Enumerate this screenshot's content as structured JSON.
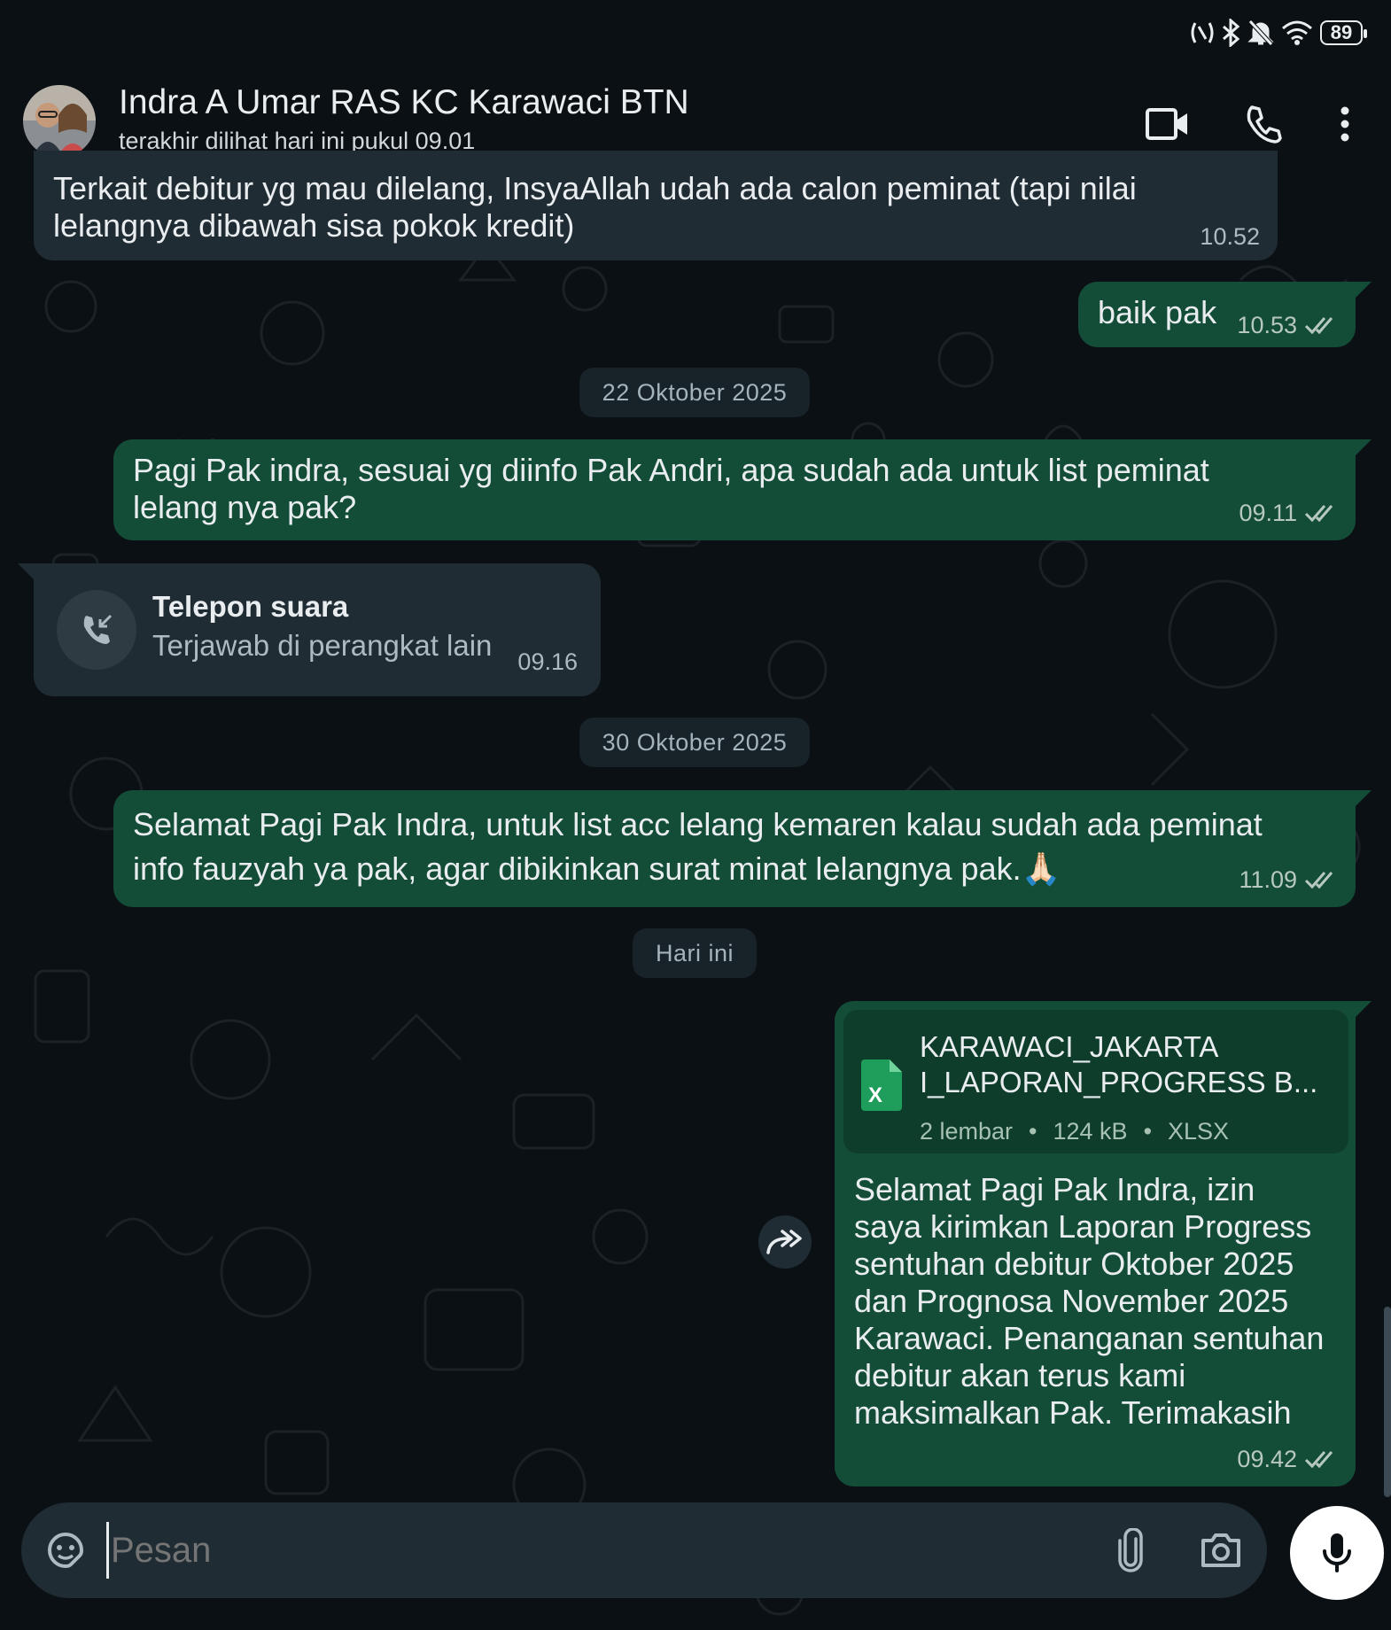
{
  "status_bar": {
    "battery": "89"
  },
  "header": {
    "contact_name": "Indra A Umar RAS KC Karawaci BTN",
    "last_seen": "terakhir dilihat hari ini pukul 09.01"
  },
  "messages": {
    "m1": {
      "text_line1": "Terkait debitur yg mau dilelang, InsyaAllah udah ada calon peminat (tapi nilai",
      "text_line2": "lelangnya dibawah sisa pokok kredit)",
      "time": "10.52"
    },
    "m2": {
      "text": "baik pak",
      "time": "10.53"
    },
    "date1": "22 Oktober 2025",
    "m3": {
      "text_line1": "Pagi Pak indra, sesuai yg diinfo Pak Andri, apa sudah ada untuk list peminat",
      "text_line2": "lelang nya pak?",
      "time": "09.11"
    },
    "call": {
      "title": "Telepon suara",
      "subtitle": "Terjawab di perangkat lain",
      "time": "09.16"
    },
    "date2": "30 Oktober 2025",
    "m4": {
      "text_line1": "Selamat Pagi Pak Indra, untuk list acc lelang kemaren kalau sudah ada peminat",
      "text_line2": "info fauzyah ya pak, agar dibikinkan surat minat lelangnya pak.",
      "emoji": "🙏🏻",
      "time": "11.09"
    },
    "date3": "Hari ini",
    "m5": {
      "file_name_line1": "KARAWACI_JAKARTA",
      "file_name_line2": "I_LAPORAN_PROGRESS B...",
      "file_pages": "2 lembar",
      "file_size": "124 kB",
      "file_type": "XLSX",
      "file_icon_letter": "X",
      "caption_lines": [
        "Selamat Pagi Pak Indra, izin",
        "saya kirimkan Laporan Progress",
        "sentuhan debitur Oktober 2025",
        "dan Prognosa November 2025",
        "Karawaci. Penanganan sentuhan",
        "debitur akan terus kami",
        "maksimalkan Pak. Terimakasih"
      ],
      "time": "09.42"
    }
  },
  "input": {
    "placeholder": "Pesan"
  },
  "colors": {
    "background": "#0b1014",
    "incoming": "#202c33",
    "outgoing": "#144d37",
    "accent": "#25d366",
    "read_tick": "#b7c9bf"
  }
}
